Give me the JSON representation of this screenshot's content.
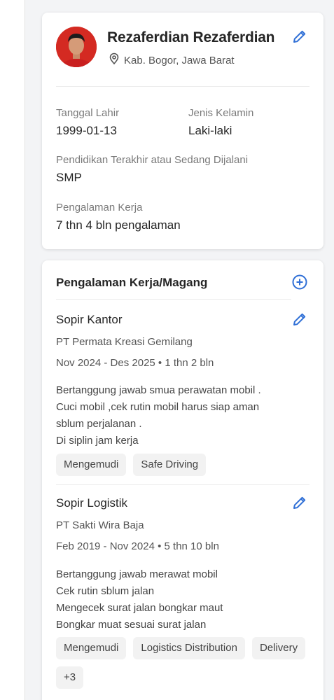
{
  "profile": {
    "name": "Rezaferdian Rezaferdian",
    "location": "Kab. Bogor, Jawa Barat",
    "birth_label": "Tanggal Lahir",
    "birth_value": "1999-01-13",
    "gender_label": "Jenis Kelamin",
    "gender_value": "Laki-laki",
    "education_label": "Pendidikan Terakhir atau Sedang Dijalani",
    "education_value": "SMP",
    "experience_label": "Pengalaman Kerja",
    "experience_value": "7 thn 4 bln pengalaman"
  },
  "experience": {
    "title": "Pengalaman Kerja/Magang",
    "jobs": [
      {
        "title": "Sopir Kantor",
        "company": "PT Permata Kreasi Gemilang",
        "period": "Nov 2024 - Des 2025 • 1 thn 2 bln",
        "description": [
          "Bertanggung jawab smua perawatan mobil .",
          "Cuci mobil ,cek rutin mobil harus siap aman",
          "sblum perjalanan .",
          "Di siplin jam kerja"
        ],
        "tags": [
          "Mengemudi",
          "Safe Driving"
        ]
      },
      {
        "title": "Sopir Logistik",
        "company": "PT Sakti Wira Baja",
        "period": "Feb 2019 - Nov 2024 • 5 thn 10 bln",
        "description": [
          "Bertanggung jawab merawat mobil",
          "Cek rutin sblum jalan",
          "Mengecek surat jalan bongkar maut",
          "Bongkar muat sesuai surat jalan"
        ],
        "tags": [
          "Mengemudi",
          "Logistics Distribution",
          "Delivery",
          "+3"
        ]
      }
    ]
  },
  "colors": {
    "accent": "#2f6fd6",
    "avatar_bg": "#d42a22"
  },
  "icons": [
    "edit-pencil-icon",
    "location-pin-icon",
    "add-circle-icon"
  ]
}
